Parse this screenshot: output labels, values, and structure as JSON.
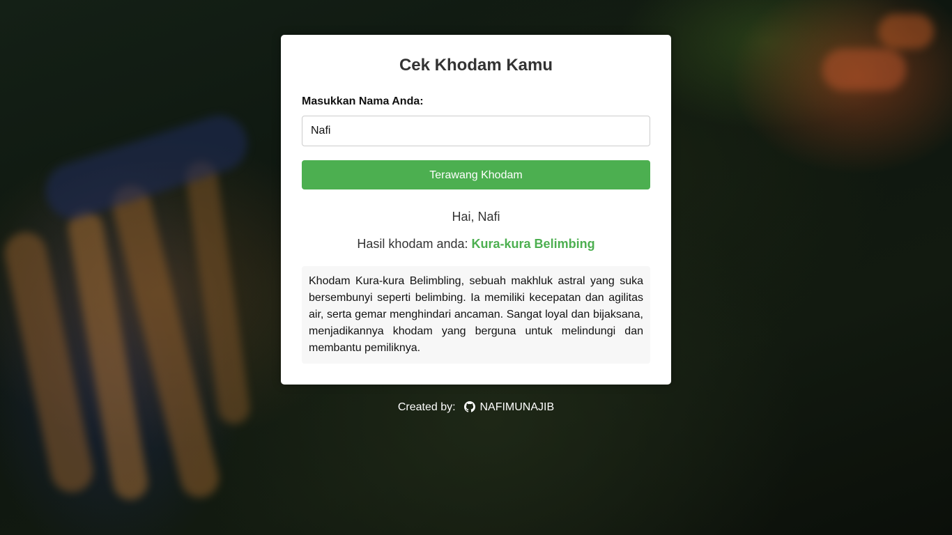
{
  "page": {
    "title": "Cek Khodam Kamu"
  },
  "form": {
    "label": "Masukkan Nama Anda:",
    "input_value": "Nafi",
    "button_label": "Terawang Khodam"
  },
  "result": {
    "greeting": "Hai, Nafi",
    "result_prefix": "Hasil khodam anda:",
    "khodam_name": "Kura-kura Belimbing",
    "description": "Khodam Kura-kura Belimbling, sebuah makhluk astral yang suka bersembunyi seperti belimbing. Ia memiliki kecepatan dan agilitas air, serta gemar menghindari ancaman. Sangat loyal dan bijaksana, menjadikannya khodam yang berguna untuk melindungi dan membantu pemiliknya."
  },
  "footer": {
    "created_by": "Created by:",
    "author": "NAFIMUNAJIB",
    "icon": "github-icon"
  },
  "colors": {
    "accent": "#4caf50",
    "card": "#ffffff",
    "description_bg": "#f7f7f7"
  }
}
